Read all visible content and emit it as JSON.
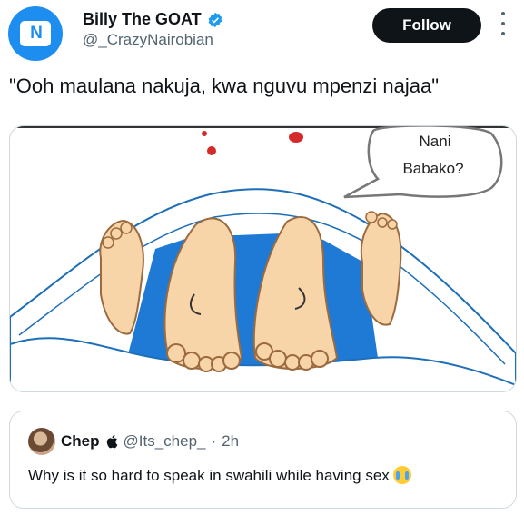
{
  "tweet": {
    "display_name": "Billy The GOAT",
    "handle": "@_CrazyNairobian",
    "follow_label": "Follow",
    "text": "\"Ooh maulana nakuja, kwa nguvu mpenzi najaa\"",
    "avatar_icon": "brand-logo-icon",
    "verified_color": "#1d9bf0"
  },
  "media": {
    "bubble_line1": "Nani",
    "bubble_line2": "Babako?"
  },
  "quote": {
    "name": "Chep",
    "badge_icon": "apple-icon",
    "handle": "@Its_chep_",
    "separator": "·",
    "time": "2h",
    "text": "Why is it so hard to speak in swahili while having sex",
    "emoji": "loudly-crying-face-icon"
  }
}
